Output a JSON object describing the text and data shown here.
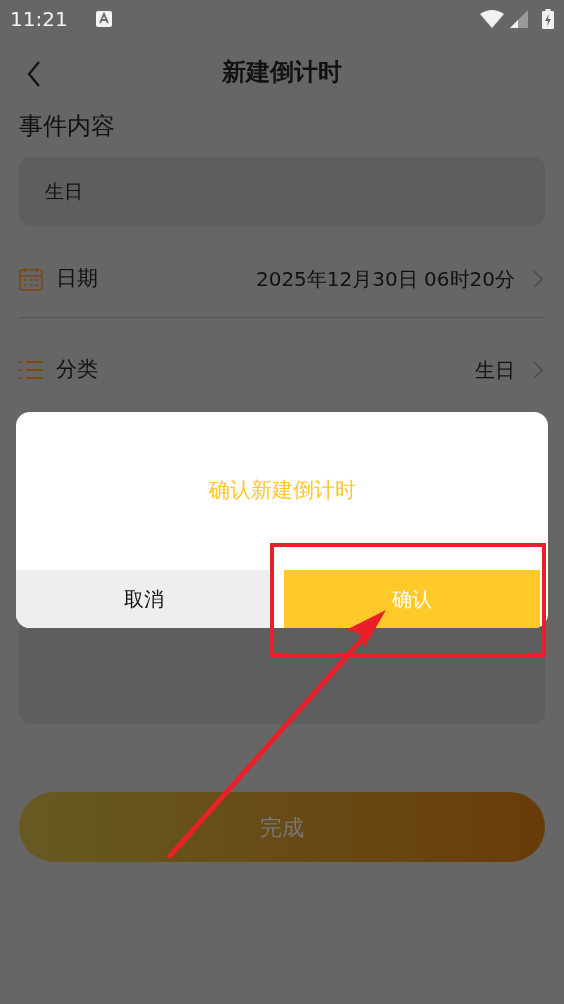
{
  "status_bar": {
    "time": "11:21"
  },
  "header": {
    "title": "新建倒计时"
  },
  "event": {
    "label": "事件内容",
    "value": "生日"
  },
  "fields": [
    {
      "kind": "date",
      "label": "日期",
      "value": "2025年12月30日 06时20分"
    },
    {
      "kind": "category",
      "label": "分类",
      "value": "生日"
    }
  ],
  "done_button": "完成",
  "dialog": {
    "message": "确认新建倒计时",
    "buttons": [
      {
        "kind": "cancel",
        "label": "取消"
      },
      {
        "kind": "confirm",
        "label": "确认"
      }
    ]
  }
}
